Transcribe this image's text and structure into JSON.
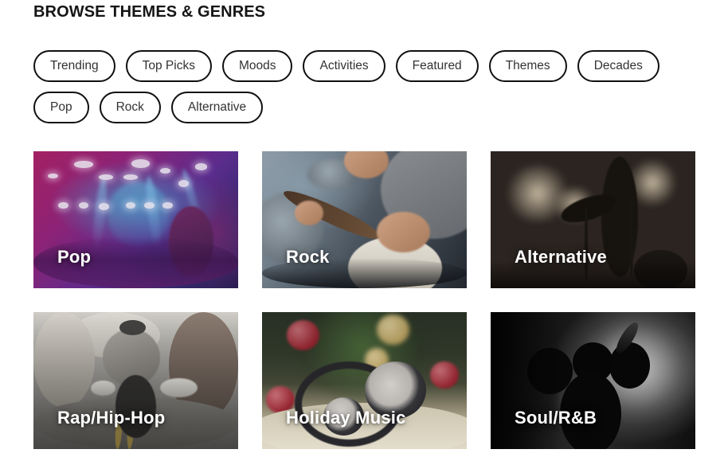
{
  "section": {
    "title": "BROWSE THEMES & GENRES"
  },
  "filters": {
    "rows": [
      [
        {
          "label": "Trending"
        },
        {
          "label": "Top Picks"
        },
        {
          "label": "Moods"
        },
        {
          "label": "Activities"
        },
        {
          "label": "Featured"
        },
        {
          "label": "Themes"
        },
        {
          "label": "Decades"
        }
      ],
      [
        {
          "label": "Pop"
        },
        {
          "label": "Rock"
        },
        {
          "label": "Alternative"
        }
      ]
    ]
  },
  "cards": [
    {
      "label": "Pop",
      "art": "concert-stage-lights-photo"
    },
    {
      "label": "Rock",
      "art": "bass-guitarist-photo"
    },
    {
      "label": "Alternative",
      "art": "silhouette-guitarist-stage-photo"
    },
    {
      "label": "Rap/Hip-Hop",
      "art": "street-dancer-photo"
    },
    {
      "label": "Holiday Music",
      "art": "headphones-christmas-tree-photo"
    },
    {
      "label": "Soul/R&B",
      "art": "silhouette-singer-microphone-photo"
    }
  ],
  "colors": {
    "page_background": "#ffffff",
    "title_text": "#151515",
    "pill_border": "#101010",
    "pill_text": "#333333",
    "pill_background": "#ffffff",
    "card_label_text": "#ffffff"
  }
}
